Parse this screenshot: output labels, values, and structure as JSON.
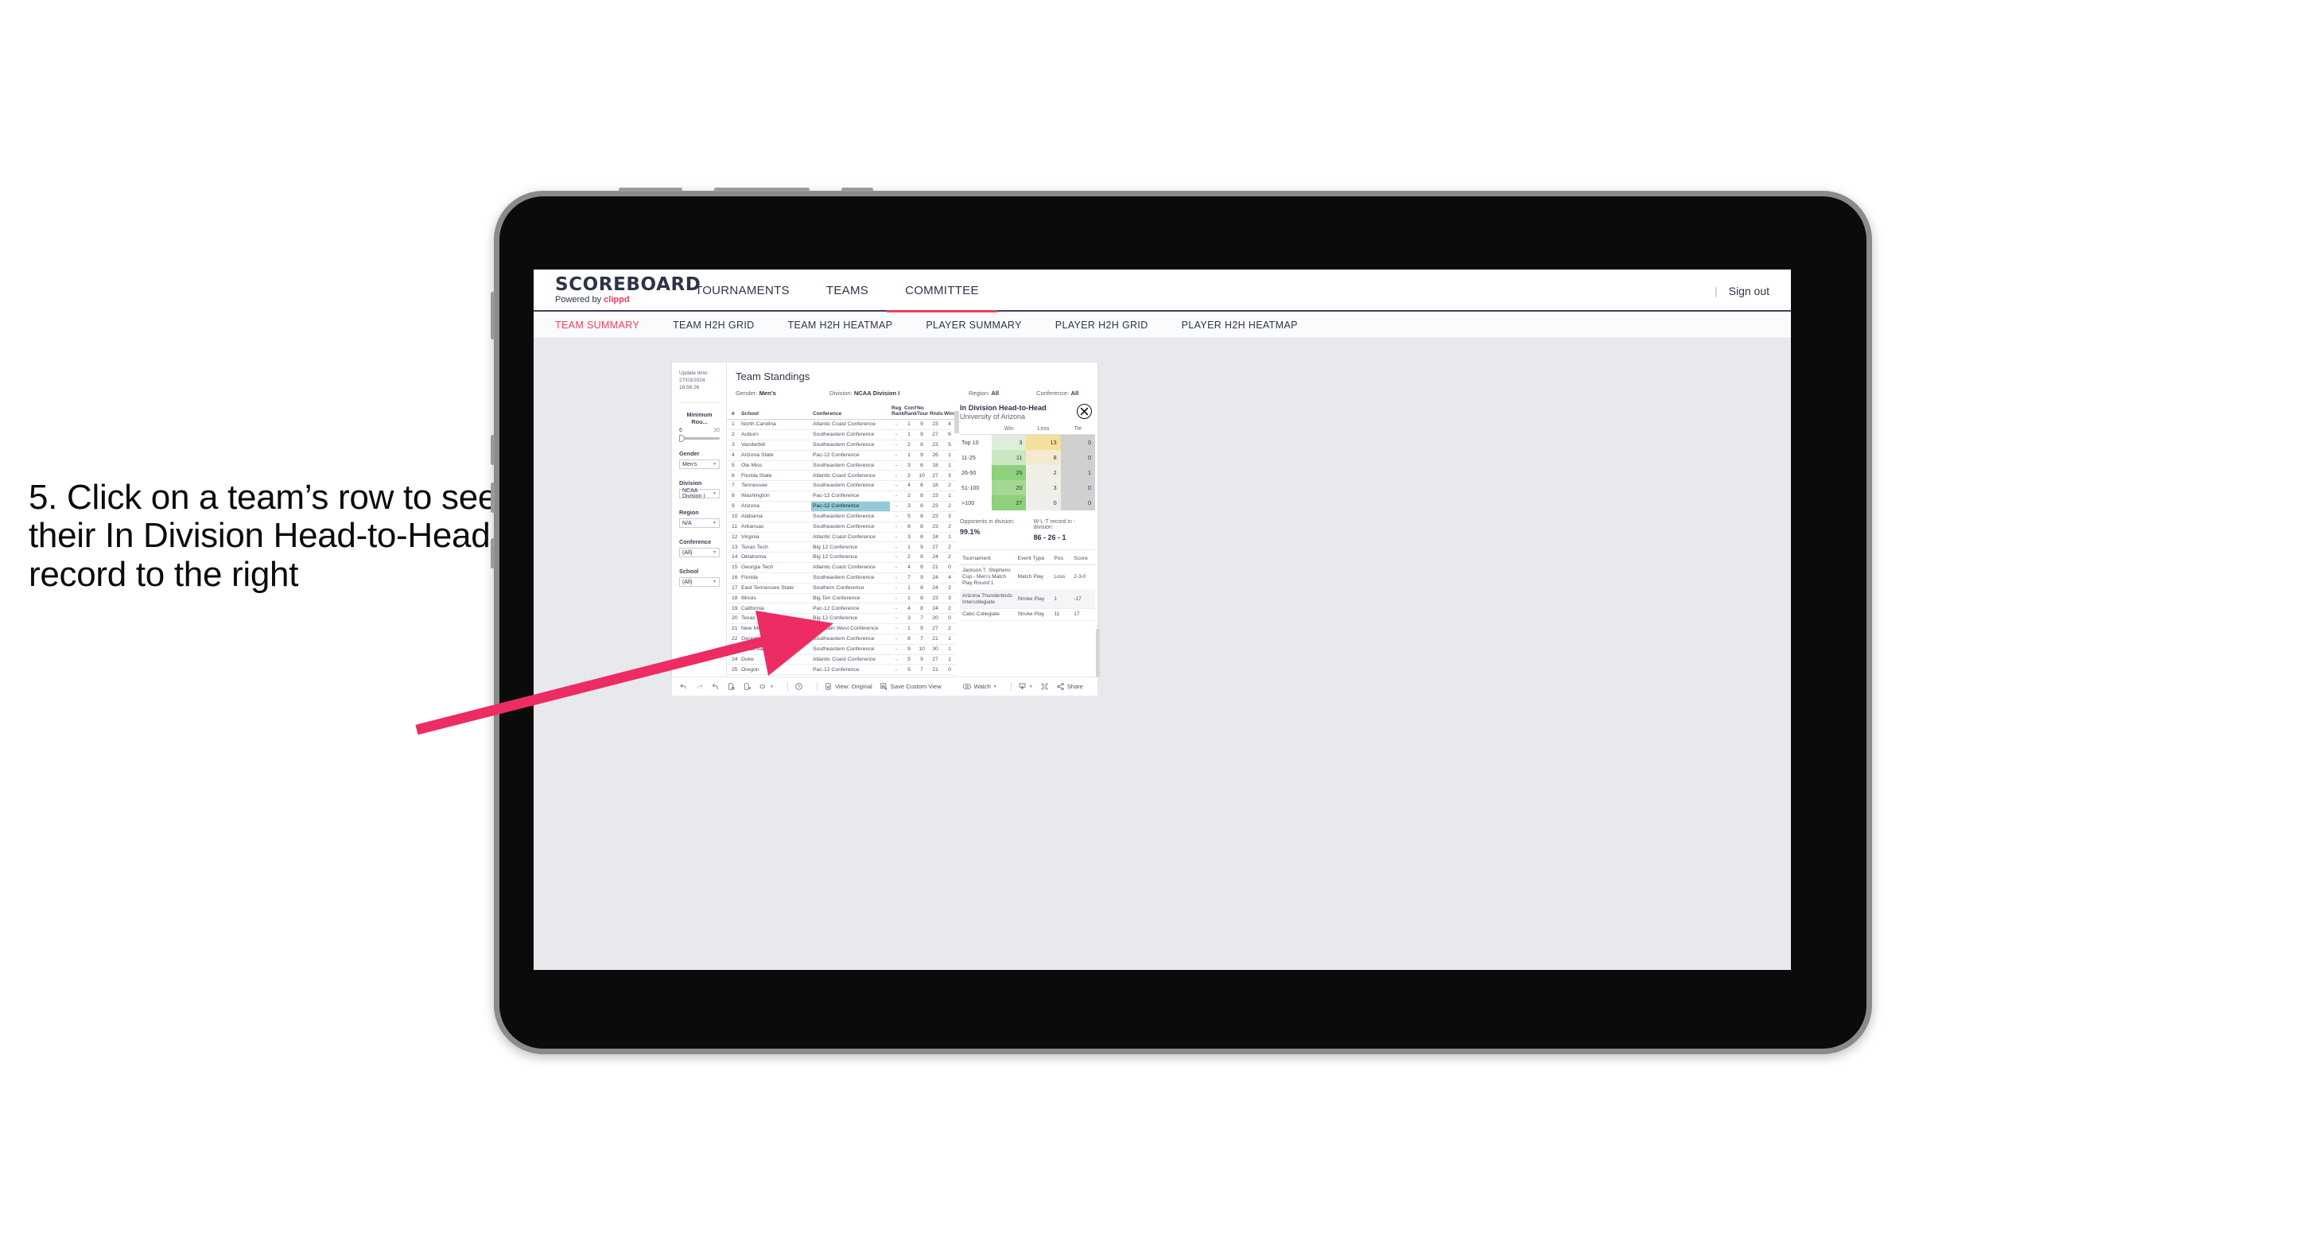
{
  "caption": {
    "text": "5. Click on a team’s row to see their In Division Head-to-Head record to the right"
  },
  "colors": {
    "accent": "#ef3e5c",
    "navy": "#2c3446",
    "selection": "#92ccd8",
    "arrow": "#ec2c62",
    "canvas": "#e8e9ed"
  },
  "topbar": {
    "logo_main": "SCOREBOARD",
    "logo_sub_prefix": "Powered by ",
    "logo_brand": "clippd",
    "nav": [
      {
        "label": "TOURNAMENTS",
        "active": false
      },
      {
        "label": "TEAMS",
        "active": false
      },
      {
        "label": "COMMITTEE",
        "active": true
      }
    ],
    "divider": "|",
    "signout": "Sign out"
  },
  "subtabs": [
    {
      "label": "TEAM SUMMARY",
      "active": true
    },
    {
      "label": "TEAM H2H GRID",
      "active": false
    },
    {
      "label": "TEAM H2H HEATMAP",
      "active": false
    },
    {
      "label": "PLAYER SUMMARY",
      "active": false
    },
    {
      "label": "PLAYER H2H GRID",
      "active": false
    },
    {
      "label": "PLAYER H2H HEATMAP",
      "active": false
    }
  ],
  "filters": {
    "update_time_label": "Update time:",
    "update_time_value": "27/03/2024 16:56:26",
    "slider": {
      "title": "Minimum Rou...",
      "min": "6",
      "max": "30"
    },
    "selects": [
      {
        "title": "Gender",
        "value": "Men’s"
      },
      {
        "title": "Division",
        "value": "NCAA Division I"
      },
      {
        "title": "Region",
        "value": "N/A"
      },
      {
        "title": "Conference",
        "value": "(All)"
      },
      {
        "title": "School",
        "value": "(All)"
      }
    ]
  },
  "viz": {
    "title": "Team Standings",
    "header_filters": [
      {
        "label": "Gender:",
        "value": "Men’s"
      },
      {
        "label": "Division:",
        "value": "NCAA Division I"
      },
      {
        "label": "Region:",
        "value": "All"
      },
      {
        "label": "Conference:",
        "value": "All"
      }
    ]
  },
  "standings": {
    "columns": [
      "#",
      "School",
      "Conference",
      "Reg Rank",
      "Conf Rank",
      "No Tour",
      "Rnds",
      "Wins"
    ],
    "column_lines": [
      [
        "#",
        ""
      ],
      [
        "School",
        ""
      ],
      [
        "Conference",
        ""
      ],
      [
        "Reg",
        "Rank"
      ],
      [
        "Conf",
        "Rank"
      ],
      [
        "No",
        "Tour"
      ],
      [
        "",
        "Rnds"
      ],
      [
        "",
        "Wins"
      ]
    ],
    "selected_row_index": 8,
    "rows": [
      {
        "rank": "1",
        "school": "North Carolina",
        "conference": "Atlantic Coast Conference",
        "reg_rank": "-",
        "conf_rank": "1",
        "no_tour": "9",
        "rnds": "23",
        "wins": "4"
      },
      {
        "rank": "2",
        "school": "Auburn",
        "conference": "Southeastern Conference",
        "reg_rank": "-",
        "conf_rank": "1",
        "no_tour": "9",
        "rnds": "27",
        "wins": "6"
      },
      {
        "rank": "3",
        "school": "Vanderbilt",
        "conference": "Southeastern Conference",
        "reg_rank": "-",
        "conf_rank": "2",
        "no_tour": "8",
        "rnds": "23",
        "wins": "5"
      },
      {
        "rank": "4",
        "school": "Arizona State",
        "conference": "Pac-12 Conference",
        "reg_rank": "-",
        "conf_rank": "1",
        "no_tour": "9",
        "rnds": "26",
        "wins": "1"
      },
      {
        "rank": "5",
        "school": "Ole Miss",
        "conference": "Southeastern Conference",
        "reg_rank": "-",
        "conf_rank": "3",
        "no_tour": "6",
        "rnds": "18",
        "wins": "1"
      },
      {
        "rank": "6",
        "school": "Florida State",
        "conference": "Atlantic Coast Conference",
        "reg_rank": "-",
        "conf_rank": "2",
        "no_tour": "10",
        "rnds": "27",
        "wins": "3"
      },
      {
        "rank": "7",
        "school": "Tennessee",
        "conference": "Southeastern Conference",
        "reg_rank": "-",
        "conf_rank": "4",
        "no_tour": "6",
        "rnds": "18",
        "wins": "2"
      },
      {
        "rank": "8",
        "school": "Washington",
        "conference": "Pac-12 Conference",
        "reg_rank": "-",
        "conf_rank": "2",
        "no_tour": "8",
        "rnds": "23",
        "wins": "1"
      },
      {
        "rank": "9",
        "school": "Arizona",
        "conference": "Pac-12 Conference",
        "reg_rank": "-",
        "conf_rank": "3",
        "no_tour": "8",
        "rnds": "23",
        "wins": "2"
      },
      {
        "rank": "10",
        "school": "Alabama",
        "conference": "Southeastern Conference",
        "reg_rank": "-",
        "conf_rank": "5",
        "no_tour": "8",
        "rnds": "23",
        "wins": "3"
      },
      {
        "rank": "11",
        "school": "Arkansas",
        "conference": "Southeastern Conference",
        "reg_rank": "-",
        "conf_rank": "6",
        "no_tour": "8",
        "rnds": "23",
        "wins": "2"
      },
      {
        "rank": "12",
        "school": "Virginia",
        "conference": "Atlantic Coast Conference",
        "reg_rank": "-",
        "conf_rank": "3",
        "no_tour": "8",
        "rnds": "24",
        "wins": "1"
      },
      {
        "rank": "13",
        "school": "Texas Tech",
        "conference": "Big 12 Conference",
        "reg_rank": "-",
        "conf_rank": "1",
        "no_tour": "9",
        "rnds": "27",
        "wins": "2"
      },
      {
        "rank": "14",
        "school": "Oklahoma",
        "conference": "Big 12 Conference",
        "reg_rank": "-",
        "conf_rank": "2",
        "no_tour": "8",
        "rnds": "24",
        "wins": "2"
      },
      {
        "rank": "15",
        "school": "Georgia Tech",
        "conference": "Atlantic Coast Conference",
        "reg_rank": "-",
        "conf_rank": "4",
        "no_tour": "8",
        "rnds": "21",
        "wins": "0"
      },
      {
        "rank": "16",
        "school": "Florida",
        "conference": "Southeastern Conference",
        "reg_rank": "-",
        "conf_rank": "7",
        "no_tour": "9",
        "rnds": "24",
        "wins": "4"
      },
      {
        "rank": "17",
        "school": "East Tennessee State",
        "conference": "Southern Conference",
        "reg_rank": "-",
        "conf_rank": "1",
        "no_tour": "8",
        "rnds": "24",
        "wins": "2"
      },
      {
        "rank": "18",
        "school": "Illinois",
        "conference": "Big Ten Conference",
        "reg_rank": "-",
        "conf_rank": "1",
        "no_tour": "8",
        "rnds": "23",
        "wins": "3"
      },
      {
        "rank": "19",
        "school": "California",
        "conference": "Pac-12 Conference",
        "reg_rank": "-",
        "conf_rank": "4",
        "no_tour": "8",
        "rnds": "24",
        "wins": "2"
      },
      {
        "rank": "20",
        "school": "Texas",
        "conference": "Big 12 Conference",
        "reg_rank": "-",
        "conf_rank": "3",
        "no_tour": "7",
        "rnds": "20",
        "wins": "0"
      },
      {
        "rank": "21",
        "school": "New Mexico",
        "conference": "Mountain West Conference",
        "reg_rank": "-",
        "conf_rank": "1",
        "no_tour": "9",
        "rnds": "27",
        "wins": "2"
      },
      {
        "rank": "22",
        "school": "Georgia",
        "conference": "Southeastern Conference",
        "reg_rank": "-",
        "conf_rank": "8",
        "no_tour": "7",
        "rnds": "21",
        "wins": "1"
      },
      {
        "rank": "23",
        "school": "Texas A&M",
        "conference": "Southeastern Conference",
        "reg_rank": "-",
        "conf_rank": "9",
        "no_tour": "10",
        "rnds": "30",
        "wins": "1"
      },
      {
        "rank": "24",
        "school": "Duke",
        "conference": "Atlantic Coast Conference",
        "reg_rank": "-",
        "conf_rank": "5",
        "no_tour": "9",
        "rnds": "27",
        "wins": "1"
      },
      {
        "rank": "25",
        "school": "Oregon",
        "conference": "Pac-12 Conference",
        "reg_rank": "-",
        "conf_rank": "5",
        "no_tour": "7",
        "rnds": "21",
        "wins": "0"
      }
    ]
  },
  "h2h": {
    "title": "In Division Head-to-Head",
    "subtitle": "University of Arizona",
    "close_icon": "close-icon",
    "columns": [
      "Win",
      "Loss",
      "Tie"
    ],
    "rows": [
      {
        "label": "Top 10",
        "win": "3",
        "loss": "13",
        "tie": "0",
        "win_color": "#dfeddc",
        "loss_color": "#f2e09b",
        "tie_color": "#d0d0d0"
      },
      {
        "label": "11-25",
        "win": "11",
        "loss": "8",
        "tie": "0",
        "win_color": "#cbe6c2",
        "loss_color": "#f5ead0",
        "tie_color": "#d0d0d0"
      },
      {
        "label": "26-50",
        "win": "25",
        "loss": "2",
        "tie": "1",
        "win_color": "#8ed07c",
        "loss_color": "#efefe8",
        "tie_color": "#d0d0d0"
      },
      {
        "label": "51-100",
        "win": "20",
        "loss": "3",
        "tie": "0",
        "win_color": "#a4d893",
        "loss_color": "#efefe8",
        "tie_color": "#d0d0d0"
      },
      {
        "label": ">100",
        "win": "27",
        "loss": "0",
        "tie": "0",
        "win_color": "#8ed07c",
        "loss_color": "#eeeeea",
        "tie_color": "#d0d0d0"
      }
    ],
    "footer": [
      {
        "label": "Opponents in division:",
        "value": "99.1%"
      },
      {
        "label": "W-L-T record in -division:",
        "value": "86 - 26 - 1"
      }
    ]
  },
  "tournaments": {
    "columns": [
      "Tournament",
      "Event Type",
      "Pos",
      "Score"
    ],
    "rows": [
      {
        "name": "Jackson T. Stephens Cup - Men’s Match Play Round 1",
        "type": "Match Play",
        "pos": "Loss",
        "score": "2-3-0"
      },
      {
        "name": "Arizona Thunderbirds Intercollegiate",
        "type": "Stroke Play",
        "pos": "1",
        "score": "-17"
      },
      {
        "name": "Cabo Collegiate",
        "type": "Stroke Play",
        "pos": "11",
        "score": "17"
      }
    ]
  },
  "toolbar": {
    "items": [
      {
        "name": "undo-icon",
        "label": ""
      },
      {
        "name": "redo-icon",
        "label": ""
      },
      {
        "name": "revert-icon",
        "label": ""
      },
      {
        "name": "refresh-data-icon",
        "label": ""
      },
      {
        "name": "pause-updates-icon",
        "label": ""
      },
      {
        "name": "highlight-icon",
        "label": ""
      },
      {
        "name": "chevron-down-icon",
        "label": ""
      },
      {
        "name": "clock-icon",
        "label": ""
      }
    ],
    "view_label": "View: Original",
    "save_label": "Save Custom View",
    "watch_label": "Watch",
    "share_label": "Share"
  }
}
